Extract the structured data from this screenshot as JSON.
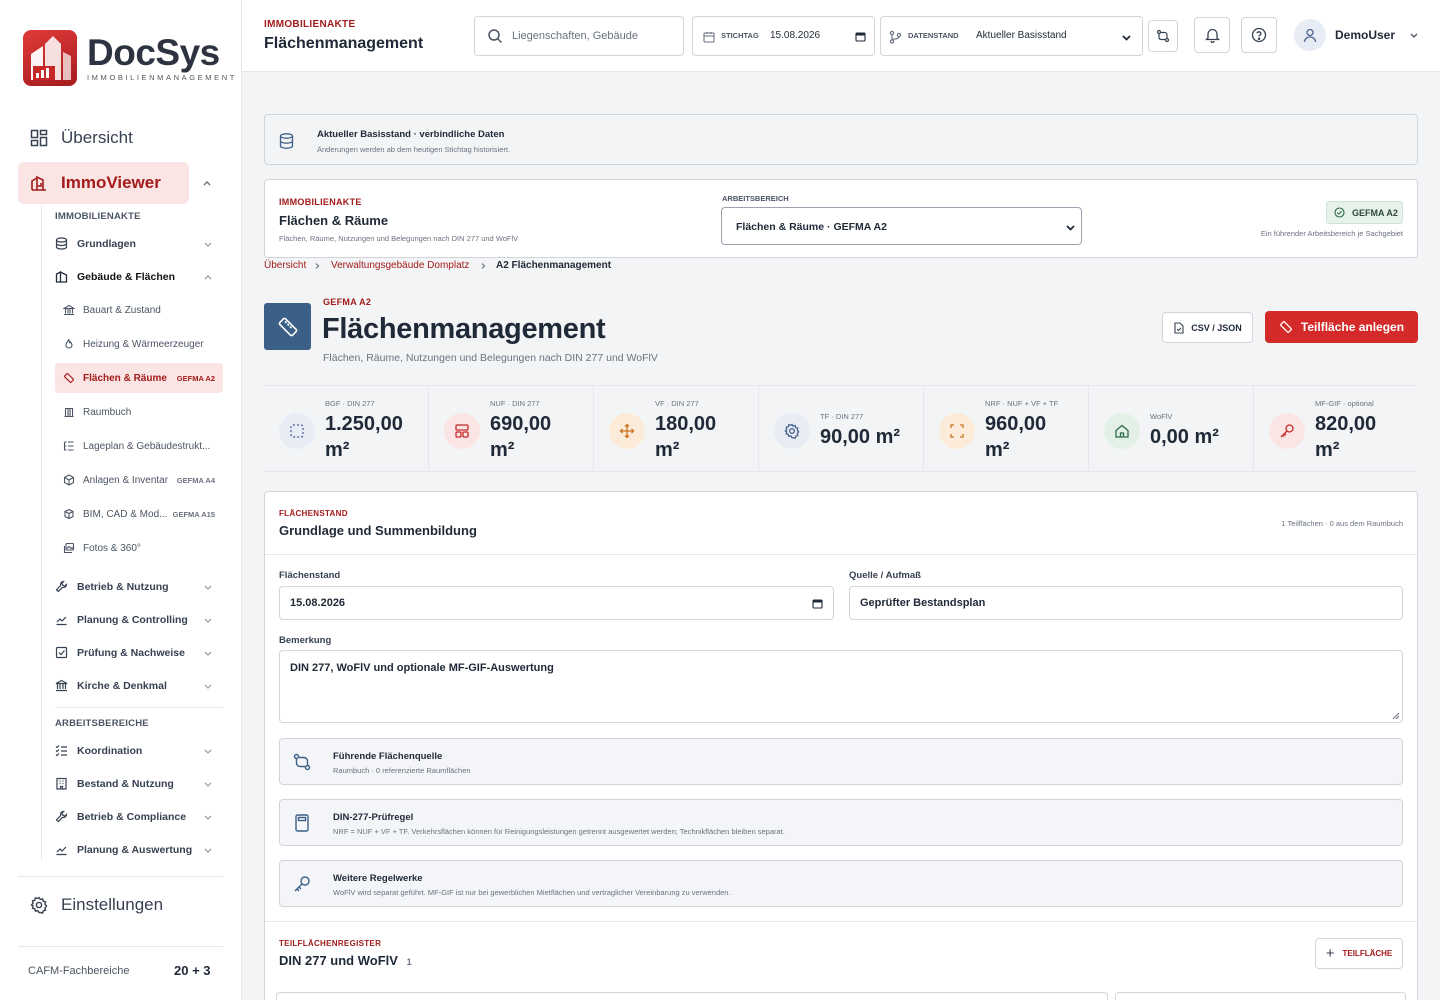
{
  "brand": {
    "name": "DocSys",
    "subtitle": "IMMOBILIENMANAGEMENT",
    "primary": "#d42a2a",
    "dark_red": "#a31b1b",
    "accent_blue": "#3b5f87"
  },
  "sidebar": {
    "overview": "Übersicht",
    "immoviewer": "ImmoViewer",
    "section_akte": "IMMOBILIENAKTE",
    "grundlagen": "Grundlagen",
    "gebaeude": "Gebäude & Flächen",
    "subs": [
      {
        "label": "Bauart & Zustand",
        "badge": "",
        "icon": "bank-icon"
      },
      {
        "label": "Heizung & Wärmeerzeuger",
        "badge": "",
        "icon": "flame-icon"
      },
      {
        "label": "Flächen & Räume",
        "badge": "GEFMA A2",
        "icon": "ruler-icon"
      },
      {
        "label": "Raumbuch",
        "badge": "",
        "icon": "columns-icon"
      },
      {
        "label": "Lageplan & Gebäudestrukt...",
        "badge": "",
        "icon": "list-tree-icon"
      },
      {
        "label": "Anlagen & Inventar",
        "badge": "GEFMA A4",
        "icon": "package-icon"
      },
      {
        "label": "BIM, CAD & Mod...",
        "badge": "GEFMA A15",
        "icon": "box-icon"
      },
      {
        "label": "Fotos & 360°",
        "badge": "",
        "icon": "images-icon"
      }
    ],
    "groups": [
      "Betrieb & Nutzung",
      "Planung & Controlling",
      "Prüfung & Nachweise",
      "Kirche & Denkmal"
    ],
    "section_arbeit": "ARBEITSBEREICHE",
    "work": [
      "Koordination",
      "Bestand & Nutzung",
      "Betrieb & Compliance",
      "Planung & Auswertung"
    ],
    "settings": "Einstellungen",
    "cafm_label": "CAFM-Fachbereiche",
    "cafm_count": "20 + 3"
  },
  "topbar": {
    "kicker": "IMMOBILIENAKTE",
    "title": "Flächenmanagement",
    "search_placeholder": "Liegenschaften, Gebäude",
    "stichtag_label": "STICHTAG",
    "stichtag_value": "15.08.2026",
    "datenstand_label": "DATENSTAND",
    "datenstand_value": "Aktueller Basisstand",
    "user": "DemoUser"
  },
  "banner": {
    "title": "Aktueller Basisstand · verbindliche Daten",
    "sub": "Änderungen werden ab dem heutigen Stichtag historisiert."
  },
  "akte": {
    "kicker": "IMMOBILIENAKTE",
    "title": "Flächen & Räume",
    "sub": "Flächen, Räume, Nutzungen und Belegungen nach DIN 277 und WoFlV",
    "area_label": "ARBEITSBEREICH",
    "area_value": "Flächen & Räume · GEFMA A2",
    "badge": "GEFMA A2",
    "hint": "Ein führender Arbeitsbereich je Sachgebiet"
  },
  "breadcrumb": [
    "Übersicht",
    "Verwaltungsgebäude Domplatz",
    "A2 Flächenmanagement"
  ],
  "page": {
    "kicker": "GEFMA A2",
    "title": "Flächenmanagement",
    "sub": "Flächen, Räume, Nutzungen und Belegungen nach DIN 277 und WoFlV",
    "export": "CSV / JSON",
    "create": "Teilfläche anlegen"
  },
  "stats": [
    {
      "label": "BGF · DIN 277",
      "value": "1.250,00",
      "unit": "m²",
      "two": true
    },
    {
      "label": "NUF · DIN 277",
      "value": "690,00",
      "unit": "m²",
      "two": true
    },
    {
      "label": "VF · DIN 277",
      "value": "180,00",
      "unit": "m²",
      "two": true
    },
    {
      "label": "TF · DIN 277",
      "value": "90,00 m²",
      "unit": "",
      "two": false
    },
    {
      "label": "NRF · NUF + VF + TF",
      "value": "960,00",
      "unit": "m²",
      "two": true
    },
    {
      "label": "WoFlV",
      "value": "0,00 m²",
      "unit": "",
      "two": false
    },
    {
      "label": "MF-GIF · optional",
      "value": "820,00",
      "unit": "m²",
      "two": true
    }
  ],
  "flaechenstand": {
    "kicker": "FLÄCHENSTAND",
    "title": "Grundlage und Summenbildung",
    "meta": "1 Teilflächen · 0 aus dem Raumbuch",
    "stand_label": "Flächenstand",
    "stand_value": "15.08.2026",
    "quelle_label": "Quelle / Aufmaß",
    "quelle_value": "Geprüfter Bestandsplan",
    "bem_label": "Bemerkung",
    "bem_value": "DIN 277, WoFlV und optionale MF-GIF-Auswertung",
    "infos": [
      {
        "title": "Führende Flächenquelle",
        "sub": "Raumbuch · 0 referenzierte Raumflächen"
      },
      {
        "title": "DIN-277-Prüfregel",
        "sub": "NRF = NUF + VF + TF. Verkehrsflächen können für Reinigungsleistungen getrennt ausgewertet werden; Technikflächen bleiben separat."
      },
      {
        "title": "Weitere Regelwerke",
        "sub": "WoFlV wird separat geführt. MF-GIF ist nur bei gewerblichen Mietflächen und vertraglicher Vereinbarung zu verwenden."
      }
    ]
  },
  "register": {
    "kicker": "TEILFLÄCHENREGISTER",
    "title": "DIN 277 und WoFlV",
    "count": "1",
    "add": "TEILFLÄCHE"
  }
}
